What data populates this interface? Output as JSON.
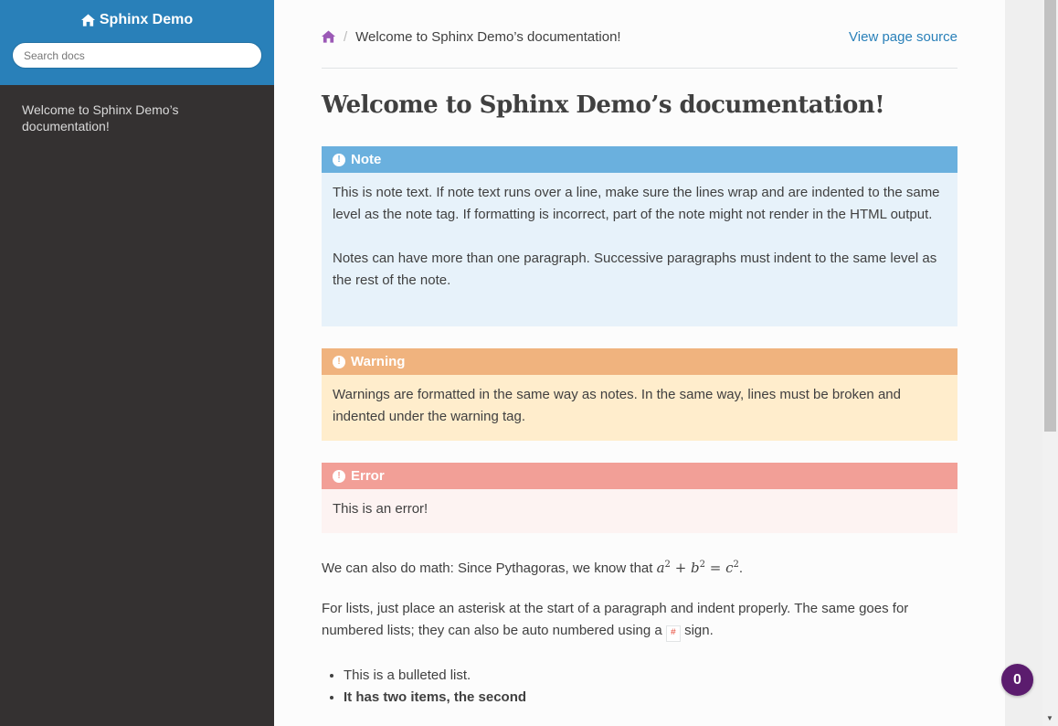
{
  "sidebar": {
    "brand": "Sphinx Demo",
    "search_placeholder": "Search docs",
    "toc": [
      "Welcome to Sphinx Demo’s documentation!"
    ]
  },
  "breadcrumbs": {
    "current": "Welcome to Sphinx Demo’s documentation!",
    "separator": "/",
    "view_source": "View page source"
  },
  "page": {
    "title": "Welcome to Sphinx Demo’s documentation!",
    "note": {
      "title": "Note",
      "paragraphs": [
        "This is note text. If note text runs over a line, make sure the lines wrap and are indented to the same level as the note tag. If formatting is incorrect, part of the note might not render in the HTML output.",
        "Notes can have more than one paragraph. Successive paragraphs must indent to the same level as the rest of the note."
      ]
    },
    "warning": {
      "title": "Warning",
      "text": "Warnings are formatted in the same way as notes. In the same way, lines must be broken and indented under the warning tag."
    },
    "error": {
      "title": "Error",
      "text": "This is an error!"
    },
    "math_prefix": "We can also do math: Since Pythagoras, we know that ",
    "lists_prefix": "For lists, just place an asterisk at the start of a paragraph and indent properly. The same goes for numbered lists; they can also be auto numbered using a ",
    "lists_code": "#",
    "lists_suffix": " sign.",
    "bullets": [
      "This is a bulleted list.",
      "It has two items, the second"
    ]
  },
  "badge": {
    "count": "0"
  },
  "colors": {
    "sidebar_top": "#2980b9",
    "sidebar_bg": "#343131",
    "note": "#6ab0de",
    "warning": "#f0b37e",
    "error": "#f29f97",
    "badge": "#5b1c6e"
  }
}
